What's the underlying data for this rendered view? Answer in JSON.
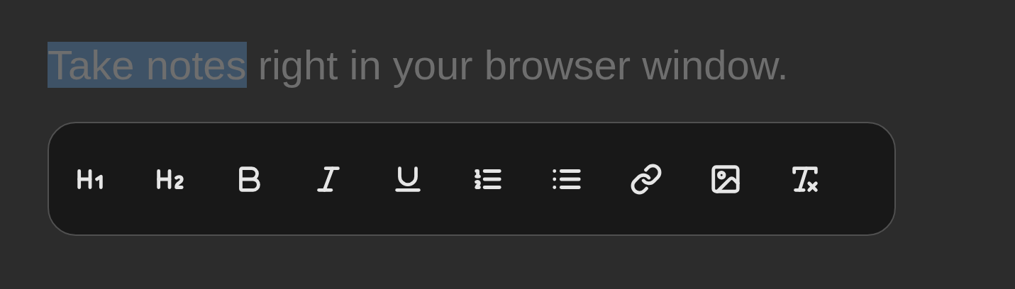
{
  "editor": {
    "segments": [
      {
        "text": "Take notes",
        "selected": true
      },
      {
        "text": " right in your browser window.",
        "selected": false
      }
    ]
  },
  "toolbar": {
    "buttons": [
      {
        "kind": "h1"
      },
      {
        "kind": "h2"
      },
      {
        "kind": "bold"
      },
      {
        "kind": "italic"
      },
      {
        "kind": "underline"
      },
      {
        "kind": "ordered-list"
      },
      {
        "kind": "bullet-list"
      },
      {
        "kind": "link"
      },
      {
        "kind": "image"
      },
      {
        "kind": "clear-format"
      }
    ]
  }
}
